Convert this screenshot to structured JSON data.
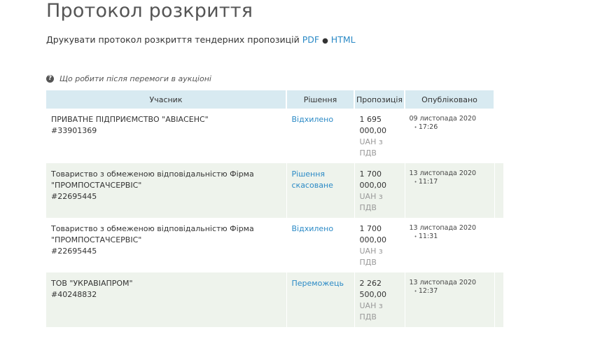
{
  "title": "Протокол розкриття",
  "print": {
    "text": "Друкувати протокол розкриття тендерних пропозицій",
    "pdf_link": "PDF",
    "separator": "●",
    "html_link": "HTML"
  },
  "help": {
    "icon": "question-circle-icon",
    "text": "Що робити після перемоги в аукціоні"
  },
  "table": {
    "headers": [
      "Учасник",
      "Рішення",
      "Пропозиція",
      "Опубліковано"
    ],
    "rows": [
      {
        "participant": "ПРИВАТНЕ ПІДПРИЄМСТВО \"АВІАСЕНС\"",
        "code": "#33901369",
        "decision": "Відхилено",
        "amount1": "1 695",
        "amount2": "000,00",
        "currency1": "UAH з",
        "currency2": "ПДВ",
        "date": "09 листопада 2020",
        "time": "17:26"
      },
      {
        "participant": "Товариство з обмеженою відповідальністю Фірма \"ПРОМПОСТАЧСЕРВІС\"",
        "code": "#22695445",
        "decision": "Рішення скасоване",
        "amount1": "1 700",
        "amount2": "000,00",
        "currency1": "UAH з",
        "currency2": "ПДВ",
        "date": "13 листопада 2020",
        "time": "11:17"
      },
      {
        "participant": "Товариство з обмеженою відповідальністю Фірма \"ПРОМПОСТАЧСЕРВІС\"",
        "code": "#22695445",
        "decision": "Відхилено",
        "amount1": "1 700",
        "amount2": "000,00",
        "currency1": "UAH з",
        "currency2": "ПДВ",
        "date": "13 листопада 2020",
        "time": "11:31"
      },
      {
        "participant": "ТОВ \"УКРАВІАПРОМ\"",
        "code": "#40248832",
        "decision": "Переможець",
        "amount1": "2 262",
        "amount2": "500,00",
        "currency1": "UAH з",
        "currency2": "ПДВ",
        "date": "13 листопада 2020",
        "time": "12:37"
      }
    ]
  },
  "colors": {
    "link": "#2b8ac6",
    "header_bg": "#d8eaf1",
    "row_alt_bg": "#eef3ec"
  }
}
